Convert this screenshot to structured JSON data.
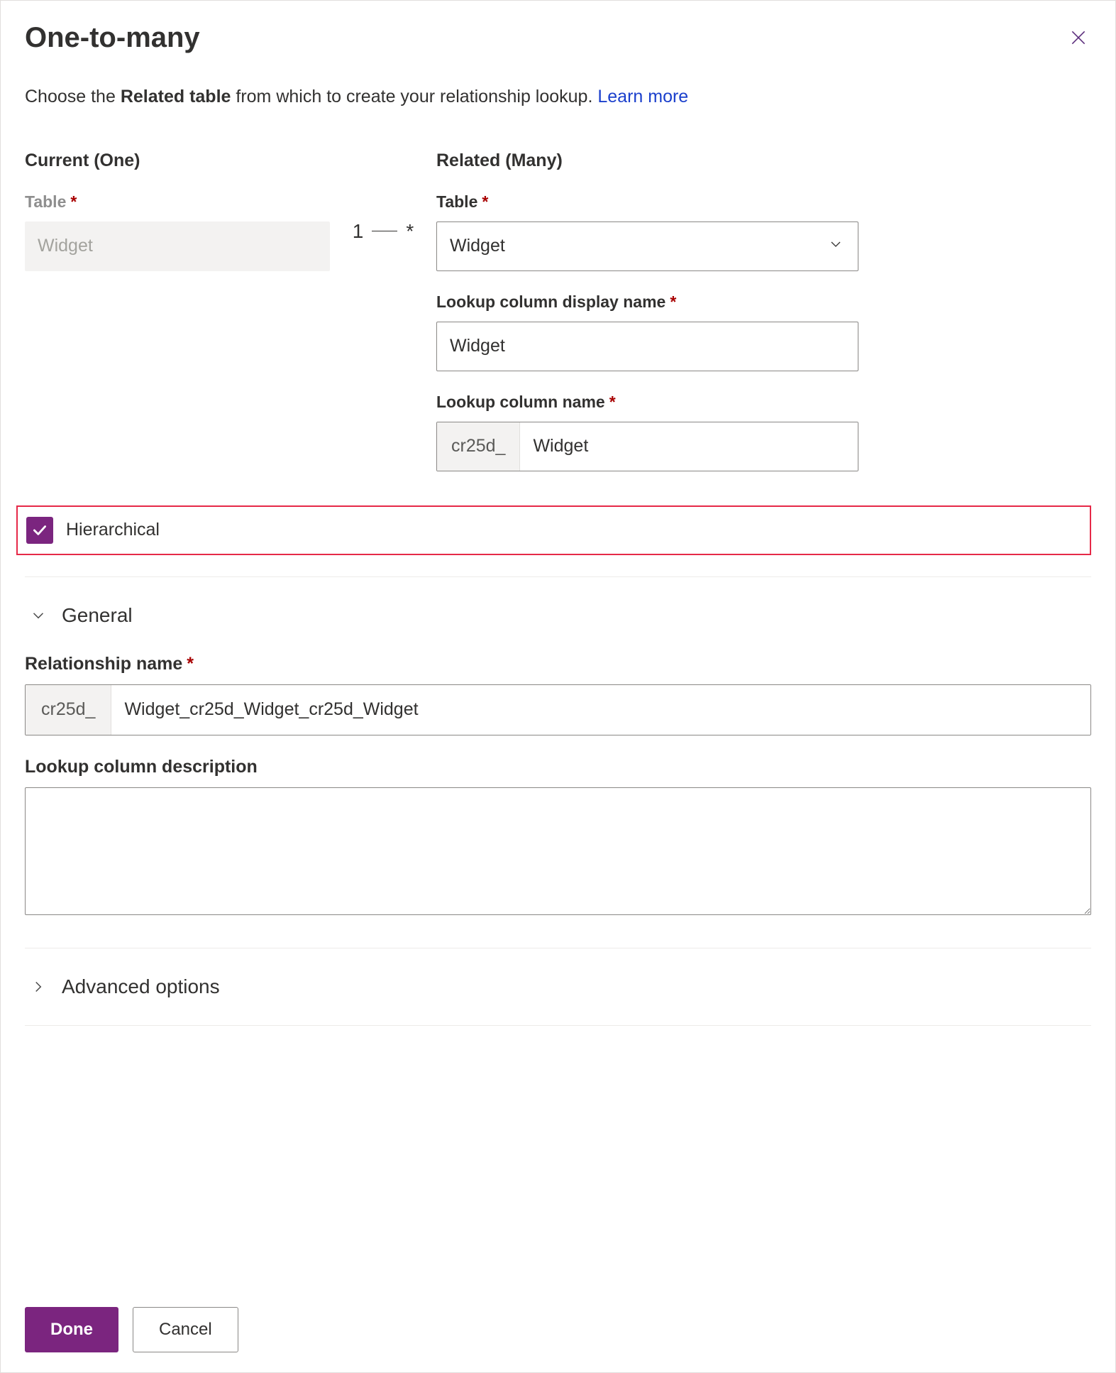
{
  "header": {
    "title": "One-to-many"
  },
  "intro": {
    "prefix": "Choose the ",
    "bold": "Related table",
    "suffix": " from which to create your relationship lookup. ",
    "link": "Learn more"
  },
  "current": {
    "heading": "Current (One)",
    "table_label": "Table",
    "table_value": "Widget"
  },
  "cardinality": {
    "left": "1",
    "right": "*"
  },
  "related": {
    "heading": "Related (Many)",
    "table_label": "Table",
    "table_value": "Widget",
    "display_name_label": "Lookup column display name",
    "display_name_value": "Widget",
    "column_name_label": "Lookup column name",
    "column_name_prefix": "cr25d_",
    "column_name_value": "Widget"
  },
  "hierarchy": {
    "label": "Hierarchical",
    "checked": true
  },
  "sections": {
    "general": "General",
    "advanced": "Advanced options"
  },
  "general": {
    "rel_name_label": "Relationship name",
    "rel_name_prefix": "cr25d_",
    "rel_name_value": "Widget_cr25d_Widget_cr25d_Widget",
    "description_label": "Lookup column description",
    "description_value": ""
  },
  "footer": {
    "done": "Done",
    "cancel": "Cancel"
  }
}
